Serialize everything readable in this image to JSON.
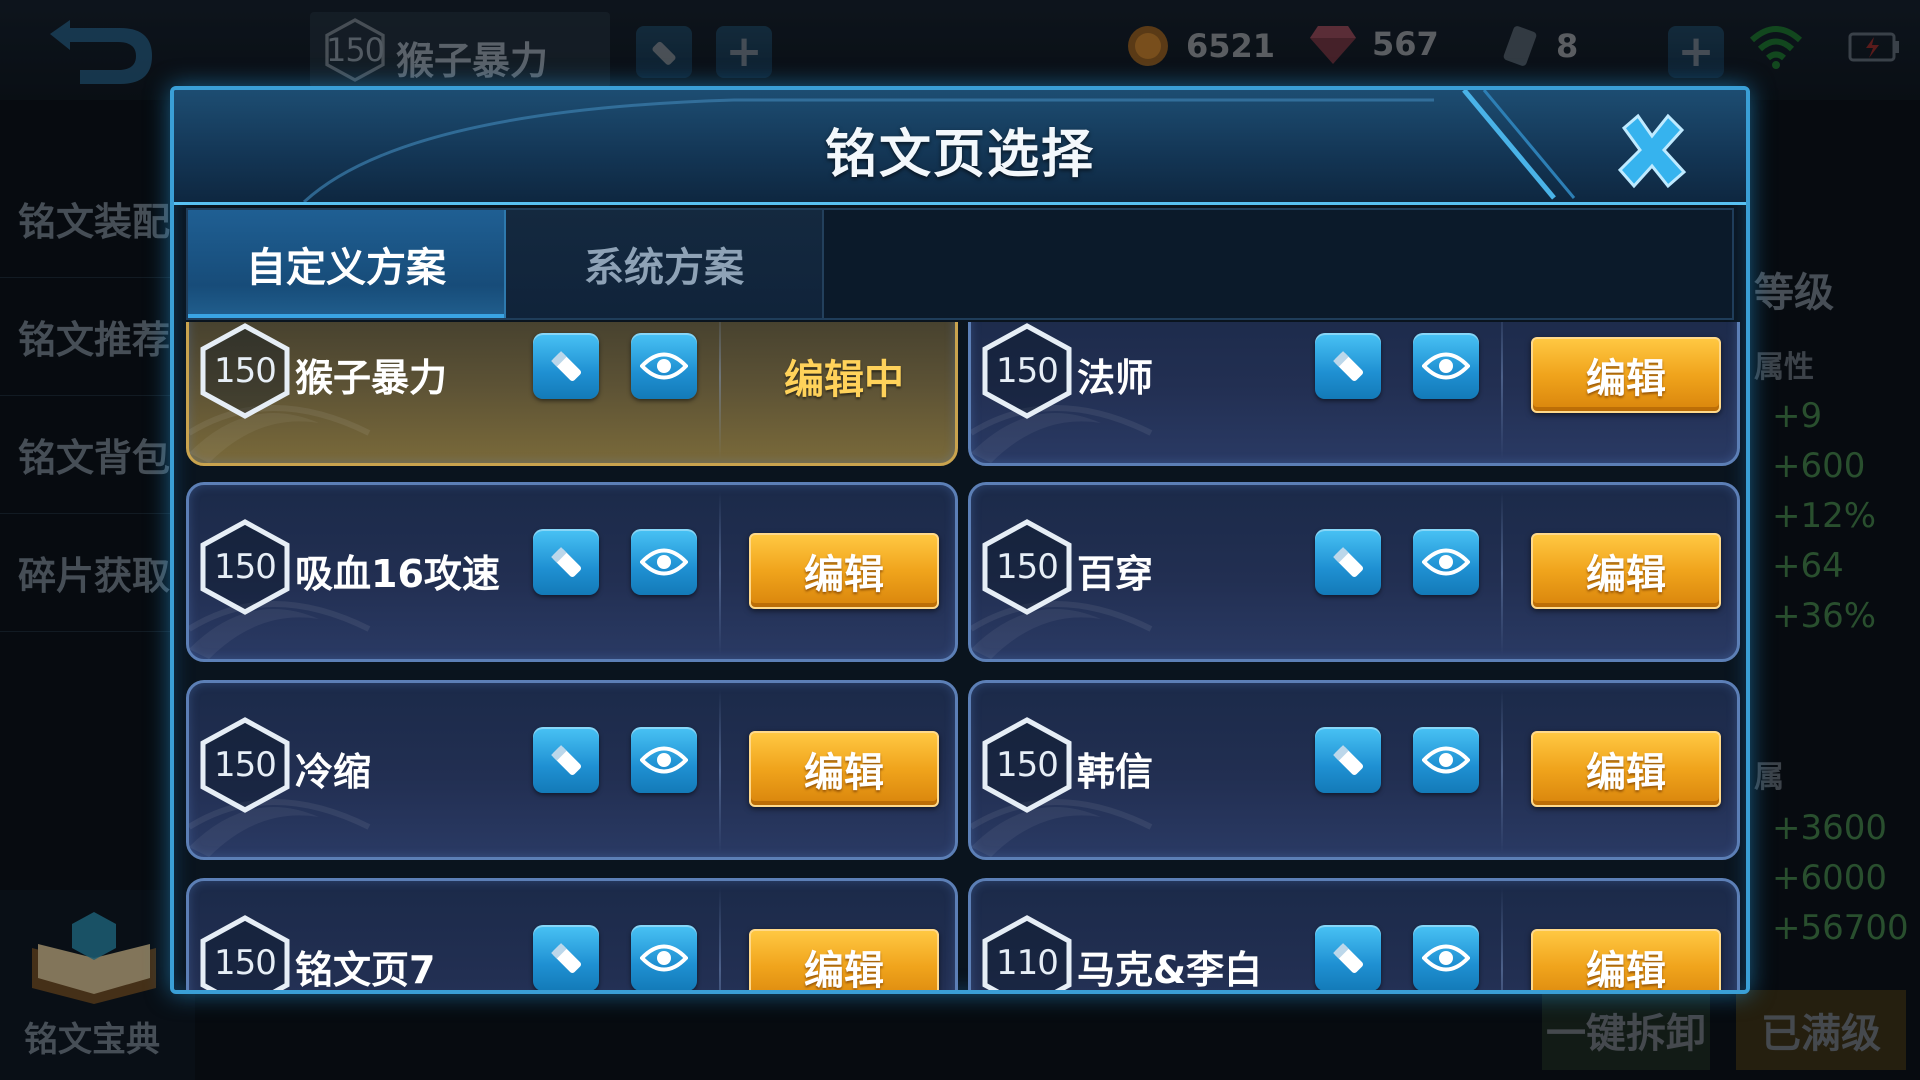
{
  "top_bar": {
    "current_scheme": {
      "level": "150",
      "name": "猴子暴力"
    },
    "gold": "6521",
    "diamonds": "567",
    "tickets": "8"
  },
  "side_menu": [
    "铭文装配",
    "铭文推荐",
    "铭文背包",
    "碎片获取"
  ],
  "bottom_left_label": "铭文宝典",
  "right_panel": {
    "level_label": "等级",
    "section_attr": "属性",
    "stats_top": [
      "+9",
      "+600",
      "+12%",
      "+64",
      "+36%"
    ],
    "section_2": "属",
    "stats_bottom": [
      "+3600",
      "+6000",
      "+56700"
    ]
  },
  "bottom_buttons": {
    "unload_all": "一键拆卸",
    "maxed": "已满级"
  },
  "modal": {
    "title": "铭文页选择",
    "tabs": {
      "custom": "自定义方案",
      "system": "系统方案"
    },
    "edit_label": "编辑",
    "editing_label": "编辑中",
    "pages": [
      {
        "level": "150",
        "name": "猴子暴力",
        "editing": true
      },
      {
        "level": "150",
        "name": "法师"
      },
      {
        "level": "150",
        "name": "吸血16攻速"
      },
      {
        "level": "150",
        "name": "百穿"
      },
      {
        "level": "150",
        "name": "冷缩"
      },
      {
        "level": "150",
        "name": "韩信"
      },
      {
        "level": "150",
        "name": "铭文页7"
      },
      {
        "level": "110",
        "name": "马克&李白"
      }
    ]
  },
  "colors": {
    "accent_blue": "#3a9fd6",
    "edit_gold": "#f0a41c",
    "editing_text": "#ffd25a",
    "stat_green": "#3f7a47"
  },
  "icons": [
    "back-arrow-icon",
    "pencil-icon",
    "plus-icon",
    "gold-coin-icon",
    "diamond-icon",
    "ticket-icon",
    "wifi-icon",
    "battery-icon",
    "close-x-icon",
    "hexagon-level-icon",
    "eye-icon",
    "book-icon"
  ]
}
